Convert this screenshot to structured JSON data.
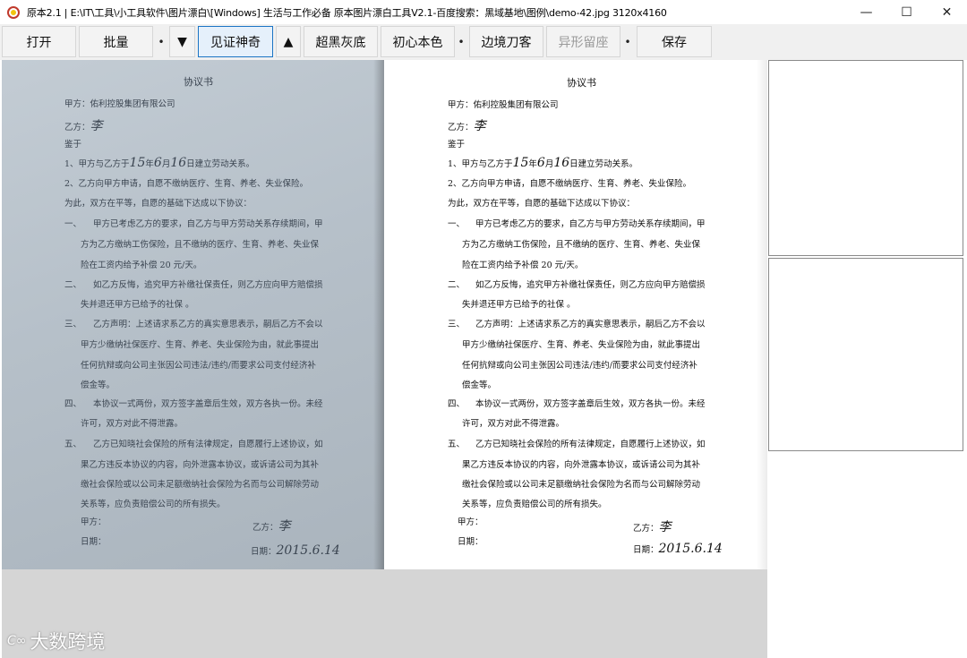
{
  "window": {
    "title": "原本2.1 | E:\\IT\\工具\\小工具软件\\图片漂白\\[Windows] 生活与工作必备 原本图片漂白工具V2.1-百度搜索：黑域基地\\图例\\demo-42.jpg 3120x4160",
    "minimize": "—",
    "maximize": "☐",
    "close": "✕"
  },
  "toolbar": {
    "open": "打开",
    "batch": "批量",
    "sep1": "•",
    "down_arrow": "▼",
    "witness": "见证神奇",
    "up_arrow": "▲",
    "super_black_gray": "超黑灰底",
    "original_color": "初心本色",
    "sep2": "•",
    "edge_knife": "边境刀客",
    "alien_seat": "异形留座",
    "sep3": "•",
    "save": "保存"
  },
  "document": {
    "title": "协议书",
    "party_a": "甲方：佑利控股集团有限公司",
    "party_b": "乙方：",
    "sig_b": "李",
    "whereas": "鉴于",
    "c1_pre": "1、甲方与乙方于",
    "c1_y": "15",
    "c1_mid1": "年",
    "c1_m": "6",
    "c1_mid2": "月",
    "c1_d": "16",
    "c1_post": "日建立劳动关系。",
    "c2": "2、乙方向甲方申请，自愿不缴纳医疗、生育、养老、失业保险。",
    "c3": "为此，双方在平等，自愿的基础下达成以下协议：",
    "p1_num": "一、",
    "p1_l1": "甲方已考虑乙方的要求，自乙方与甲方劳动关系存续期间，甲",
    "p1_l2": "方为乙方缴纳工伤保险，且不缴纳的医疗、生育、养老、失业保",
    "p1_l3": "险在工资内给予补偿  20  元/天。",
    "p2_num": "二、",
    "p2_l1": "如乙方反悔，追究甲方补缴社保责任，则乙方应向甲方赔偿损",
    "p2_l2": "失并退还甲方已给予的社保 。",
    "p3_num": "三、",
    "p3_l1": "乙方声明：上述请求系乙方的真实意思表示，嗣后乙方不会以",
    "p3_l2": "甲方少缴纳社保医疗、生育、养老、失业保险为由，就此事提出",
    "p3_l3": "任何抗辩或向公司主张因公司违法/违约/而要求公司支付经济补",
    "p3_l4": "偿金等。",
    "p4_num": "四、",
    "p4_l1": "本协议一式两份，双方签字盖章后生效，双方各执一份。未经",
    "p4_l2": "许可，双方对此不得泄露。",
    "p5_num": "五、",
    "p5_l1": "乙方已知晓社会保险的所有法律规定，自愿履行上述协议，如",
    "p5_l2": "果乙方违反本协议的内容，向外泄露本协议，或诉请公司为其补",
    "p5_l3": "缴社会保险或以公司未足额缴纳社会保险为名而与公司解除劳动",
    "p5_l4": "关系等，应负责赔偿公司的所有损失。",
    "sign_a": "甲方：",
    "sign_b_label": "乙方：",
    "sign_b_name": "李",
    "date_a": "日期：",
    "date_b": "日期：",
    "date_value": "2015.6.14"
  },
  "watermark": {
    "logo": "C∞",
    "text": "大数跨境"
  }
}
